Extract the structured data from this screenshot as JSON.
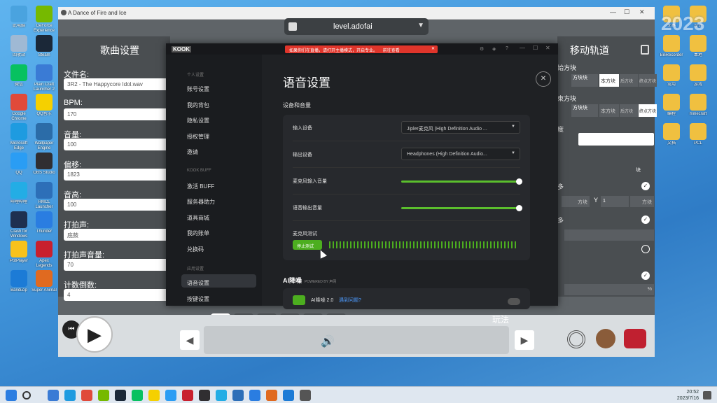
{
  "desktop": {
    "icons": [
      {
        "label": "此电脑",
        "color": "#4aa3df",
        "c": 0,
        "r": 0
      },
      {
        "label": "GeForce Experience",
        "color": "#76b900",
        "c": 1,
        "r": 0
      },
      {
        "label": "回收站",
        "color": "#9fb9d4",
        "c": 0,
        "r": 1
      },
      {
        "label": "Steam",
        "color": "#1b2838",
        "c": 1,
        "r": 1
      },
      {
        "label": "微信",
        "color": "#07c160",
        "c": 0,
        "r": 2
      },
      {
        "label": "Plain Craft Launcher 2",
        "color": "#3a7bd5",
        "c": 1,
        "r": 2
      },
      {
        "label": "Google Chrome",
        "color": "#e04a3a",
        "c": 0,
        "r": 3
      },
      {
        "label": "QQ音乐",
        "color": "#f5d000",
        "c": 1,
        "r": 3
      },
      {
        "label": "Microsoft Edge",
        "color": "#1e9be0",
        "c": 0,
        "r": 4
      },
      {
        "label": "Wallpaper Engine",
        "color": "#2b6ca8",
        "c": 1,
        "r": 4
      },
      {
        "label": "QQ",
        "color": "#2a9df4",
        "c": 0,
        "r": 5
      },
      {
        "label": "OBS Studio",
        "color": "#302e31",
        "c": 1,
        "r": 5
      },
      {
        "label": "哔哩哔哩",
        "color": "#23ade5",
        "c": 0,
        "r": 6
      },
      {
        "label": "HMCL Launcher",
        "color": "#2d6fb8",
        "c": 1,
        "r": 6
      },
      {
        "label": "Clash for Windows",
        "color": "#1e3050",
        "c": 0,
        "r": 7
      },
      {
        "label": "Thunder",
        "color": "#2a7de1",
        "c": 1,
        "r": 7
      },
      {
        "label": "PotPlayer",
        "color": "#f8c21c",
        "c": 0,
        "r": 8
      },
      {
        "label": "Apex Legends",
        "color": "#c8202e",
        "c": 1,
        "r": 8
      },
      {
        "label": "BandiZip",
        "color": "#1c7bd6",
        "c": 0,
        "r": 9
      },
      {
        "label": "Super Animal",
        "color": "#e06a20",
        "c": 1,
        "r": 9
      },
      {
        "label": "无界",
        "color": "#f0c040",
        "c": 2,
        "r": 0
      },
      {
        "label": "设计",
        "color": "#f0c040",
        "c": 3,
        "r": 0
      },
      {
        "label": "BiliRecorder",
        "color": "#f0c040",
        "c": 2,
        "r": 1
      },
      {
        "label": "本地",
        "color": "#f0c040",
        "c": 3,
        "r": 1
      },
      {
        "label": "常用",
        "color": "#f0c040",
        "c": 2,
        "r": 2
      },
      {
        "label": "游戏",
        "color": "#f0c040",
        "c": 3,
        "r": 2
      },
      {
        "label": "编程",
        "color": "#f0c040",
        "c": 2,
        "r": 3
      },
      {
        "label": "minecraft",
        "color": "#f0c040",
        "c": 3,
        "r": 3
      },
      {
        "label": "文档",
        "color": "#f0c040",
        "c": 2,
        "r": 4
      },
      {
        "label": "PCL",
        "color": "#f0c040",
        "c": 3,
        "r": 4
      }
    ]
  },
  "game": {
    "window_title": "A Dance of Fire and Ice",
    "level_name": "level.adofai",
    "left_title": "歌曲设置",
    "right_title": "移动轨道",
    "fields": [
      {
        "label": "文件名:",
        "value": "3R2 - The Happycore Idol.wav"
      },
      {
        "label": "BPM:",
        "value": "170"
      },
      {
        "label": "音量:",
        "value": "100"
      },
      {
        "label": "偏移:",
        "value": "1823"
      },
      {
        "label": "音高:",
        "value": "100"
      },
      {
        "label": "打拍声:",
        "value": "底鼓"
      },
      {
        "label": "打拍声音量:",
        "value": "70"
      },
      {
        "label": "计数倒数:",
        "value": "4"
      }
    ],
    "right_panel": {
      "h1": "始方块",
      "h2": "束方块",
      "tile_label": "方块",
      "rel": "方块块",
      "opt1": "本方块",
      "opt2": "后方块",
      "opt3": "终点方块",
      "degree": "度",
      "x_label": "X",
      "y_label": "Y",
      "y_value": "1",
      "sub": "块",
      "tile_unit": "方块",
      "pct": "%",
      "multi": "多"
    },
    "play_label": "玩法"
  },
  "kook": {
    "brand": "KOOK",
    "banner": "如果你们在直播，请打开主播模式，开启专业。",
    "banner_link": "前往查看",
    "sections": [
      {
        "heading": "个人设置",
        "items": [
          "账号设置",
          "我的背包",
          "隐私设置",
          "授权管理",
          "邀请"
        ]
      },
      {
        "heading": "KOOK BUFF",
        "items": [
          "激活 BUFF",
          "服务器助力",
          "道具商城",
          "我的账单",
          "兑换码"
        ]
      },
      {
        "heading": "应用设置",
        "items": [
          "语音设置",
          "按键设置"
        ]
      }
    ],
    "active_item": "语音设置",
    "page_title": "语音设置",
    "device_heading": "设备和音量",
    "input_label": "输入设备",
    "input_value": "Jipler麦克风 (High Definition Audio ...",
    "output_label": "输出设备",
    "output_value": "Headphones (High Definition Audio...",
    "mic_volume_label": "麦克风输入音量",
    "mic_volume": 100,
    "out_volume_label": "语音输出音量",
    "out_volume": 100,
    "mic_test_label": "麦克风测试",
    "stop_test": "停止测试",
    "ai_heading": "AI降噪",
    "ai_powered": "POWERED BY 声网",
    "ai_item": "AI降噪 2.0",
    "ai_link": "遇到问题?"
  },
  "clock": {
    "time": "20:52",
    "date": "2023/7/16"
  },
  "watermark": "2023"
}
